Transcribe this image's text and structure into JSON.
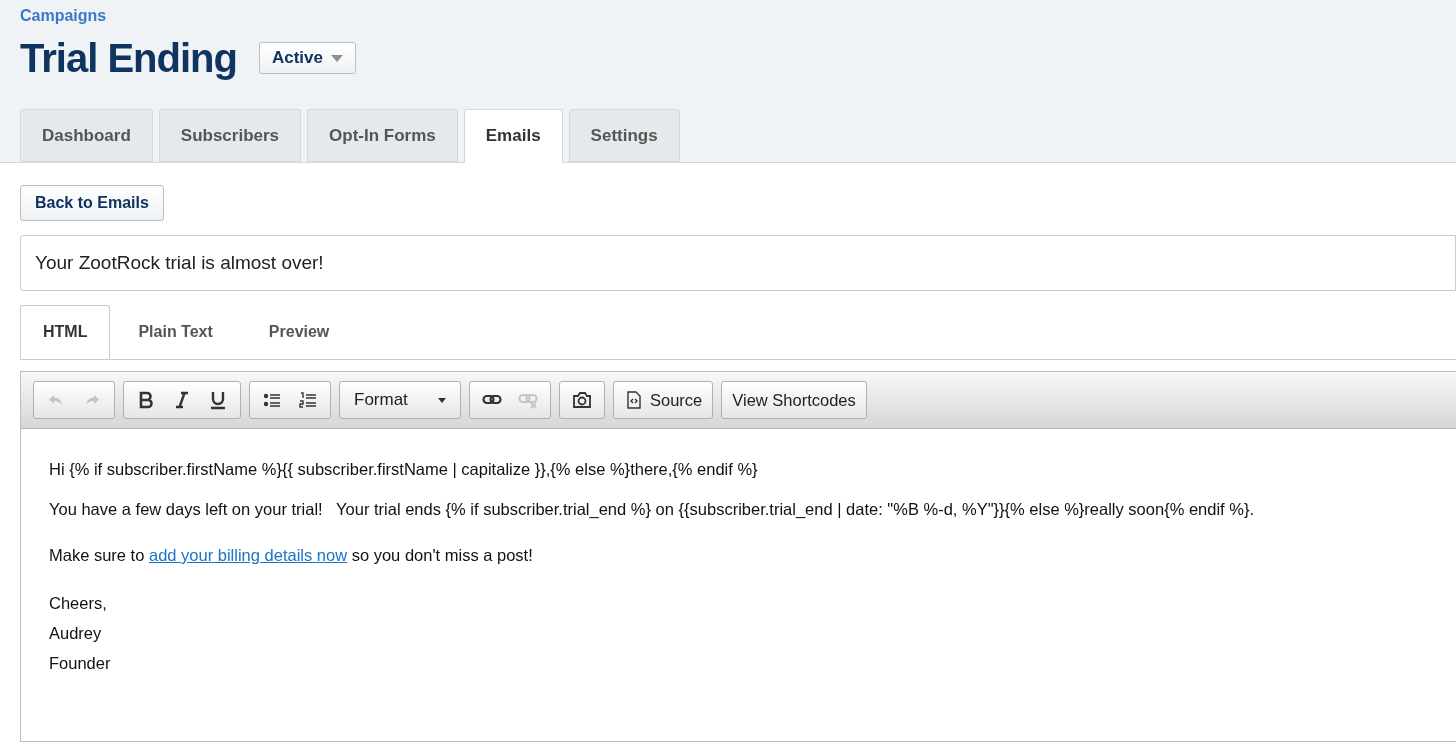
{
  "breadcrumb": "Campaigns",
  "title": "Trial Ending",
  "status_dropdown": {
    "value": "Active"
  },
  "tabs": [
    {
      "label": "Dashboard",
      "selected": false
    },
    {
      "label": "Subscribers",
      "selected": false
    },
    {
      "label": "Opt-In Forms",
      "selected": false
    },
    {
      "label": "Emails",
      "selected": true
    },
    {
      "label": "Settings",
      "selected": false
    }
  ],
  "back_button": "Back to Emails",
  "subject_field": {
    "value": "Your ZootRock trial is almost over!"
  },
  "editor_tabs": [
    {
      "label": "HTML",
      "selected": true
    },
    {
      "label": "Plain Text",
      "selected": false
    },
    {
      "label": "Preview",
      "selected": false
    }
  ],
  "toolbar": [
    {
      "kind": "group",
      "buttons": [
        {
          "disabled": true
        },
        {
          "disabled": true
        }
      ]
    },
    {
      "kind": "group",
      "buttons": [
        {
          "disabled": false
        },
        {
          "disabled": false
        },
        {
          "disabled": false
        }
      ]
    },
    {
      "kind": "group",
      "buttons": [
        {
          "disabled": false
        },
        {
          "disabled": false
        }
      ]
    },
    {
      "kind": "dropdown",
      "label": "Format"
    },
    {
      "kind": "group",
      "buttons": [
        {
          "disabled": false
        },
        {
          "disabled": true
        }
      ]
    },
    {
      "kind": "group",
      "buttons": [
        {
          "disabled": false
        }
      ]
    },
    {
      "kind": "source_button",
      "label": "Source"
    },
    {
      "kind": "button",
      "label": "View Shortcodes"
    }
  ],
  "body": [
    {
      "kind": "text",
      "text": "Hi {% if subscriber.firstName %}{{ subscriber.firstName | capitalize }},{% else %}there,{% endif %}"
    },
    {
      "kind": "text",
      "text": "You have a few days left on your trial!   Your trial ends {% if subscriber.trial_end %} on {{subscriber.trial_end | date: \"%B %-d, %Y\"}}{% else %}really soon{% endif %}."
    },
    {
      "kind": "link_text",
      "before": "Make sure to ",
      "link": "add your billing details now",
      "after": " so you don't miss a post!"
    },
    {
      "kind": "lines",
      "lines": [
        "Cheers,",
        "Audrey",
        "Founder"
      ]
    }
  ]
}
